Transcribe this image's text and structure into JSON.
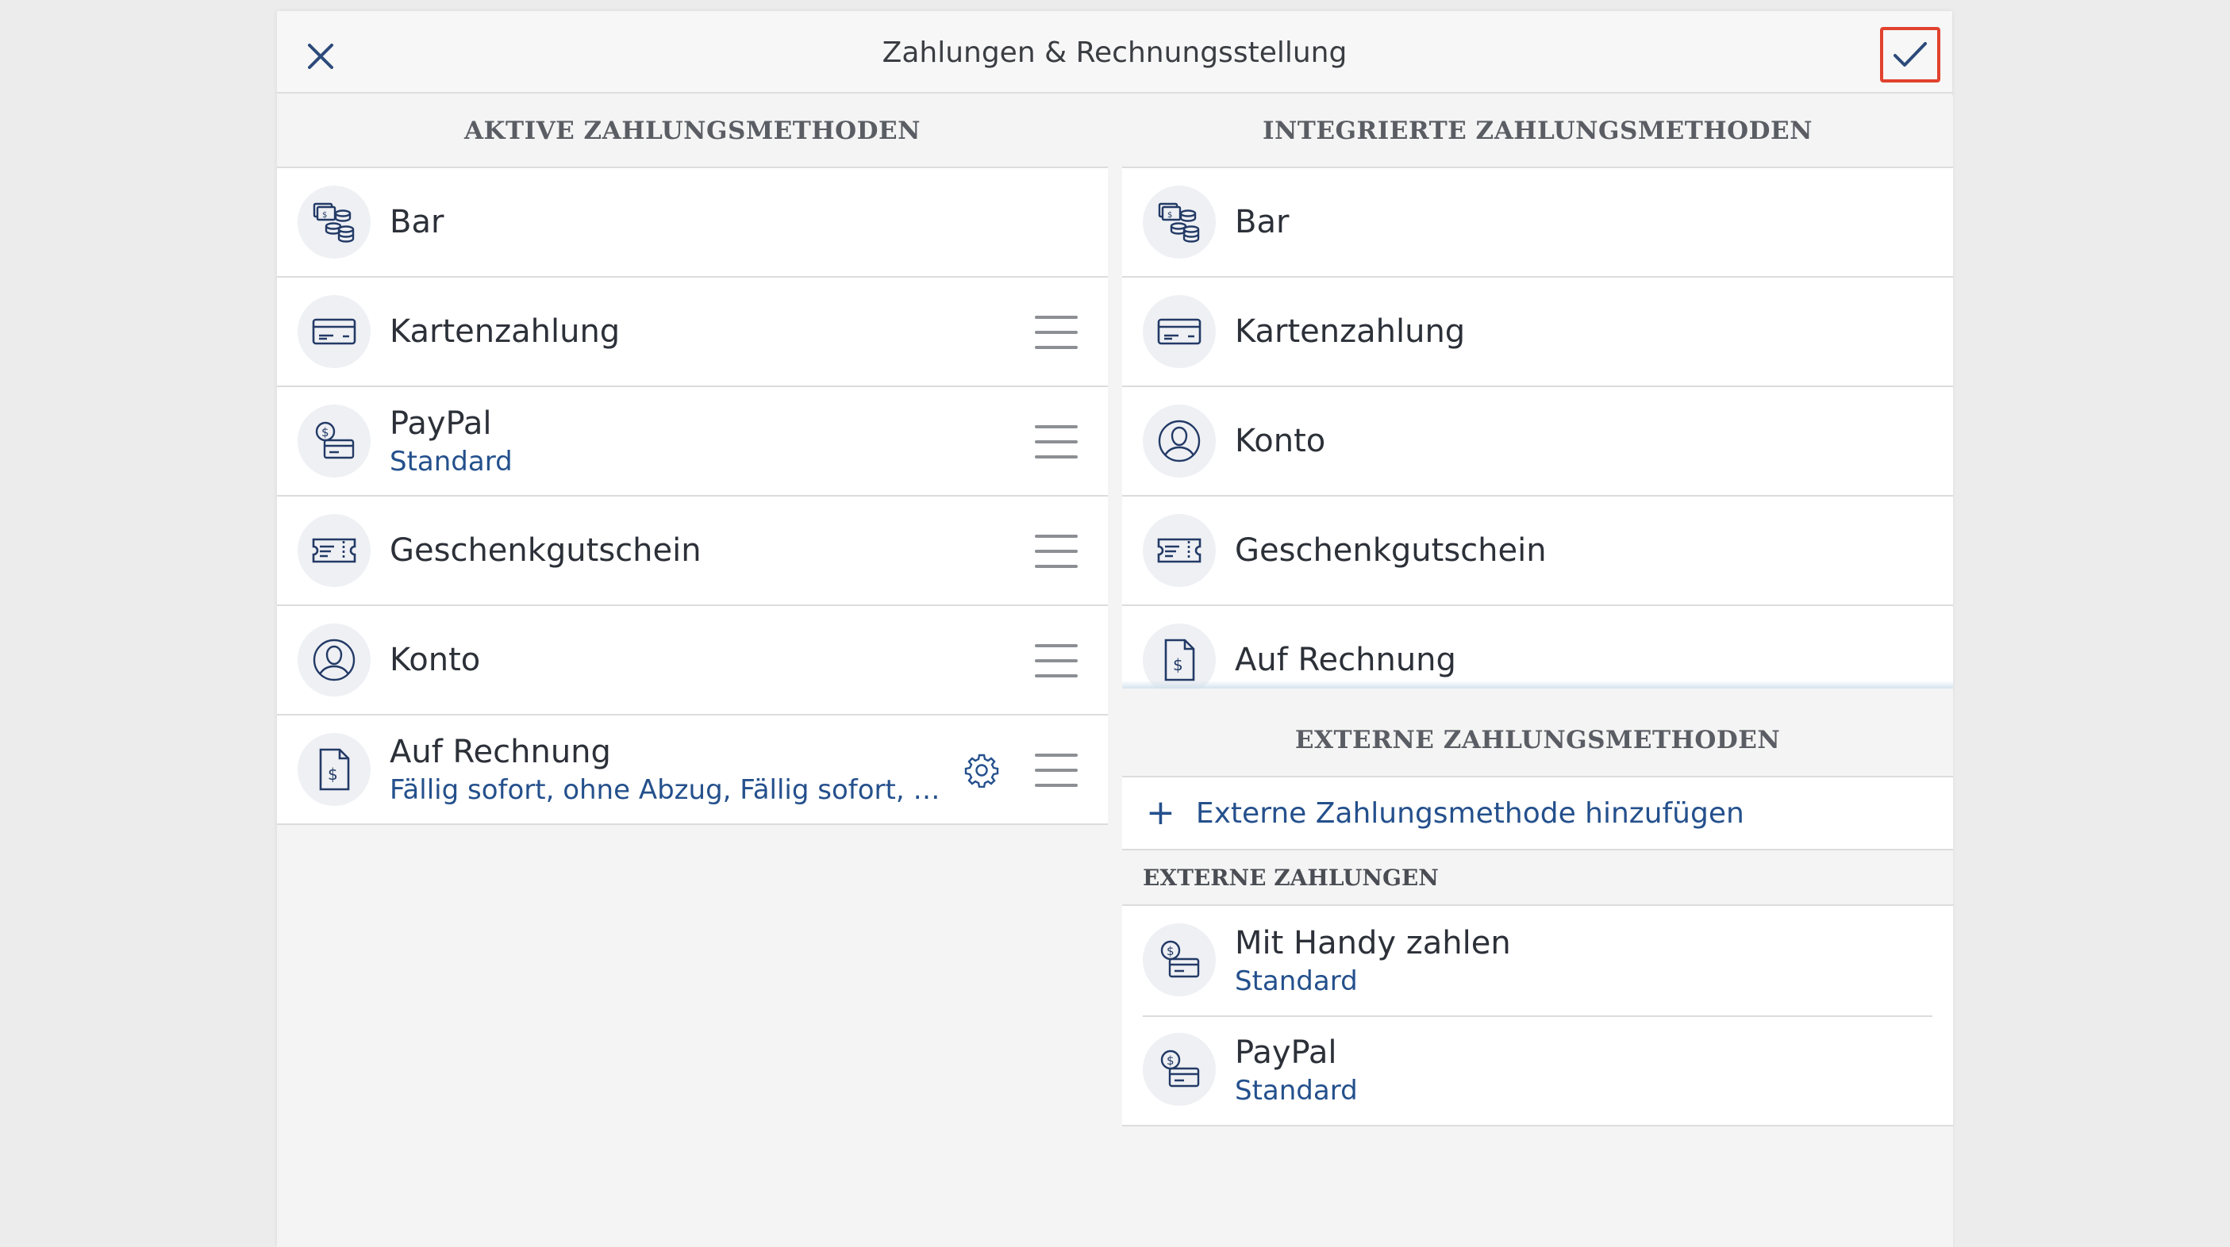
{
  "header": {
    "title": "Zahlungen & Rechnungsstellung",
    "close_icon": "close-icon",
    "confirm_icon": "checkmark-icon",
    "accent_color": "#e1422e"
  },
  "active": {
    "header": "AKTIVE ZAHLUNGSMETHODEN",
    "items": [
      {
        "title": "Bar",
        "subtitle": "",
        "icon": "cash-icon",
        "draggable": false,
        "settings": false
      },
      {
        "title": "Kartenzahlung",
        "subtitle": "",
        "icon": "card-icon",
        "draggable": true,
        "settings": false
      },
      {
        "title": "PayPal",
        "subtitle": "Standard",
        "icon": "dollar-card-icon",
        "draggable": true,
        "settings": false
      },
      {
        "title": "Geschenkgutschein",
        "subtitle": "",
        "icon": "voucher-icon",
        "draggable": true,
        "settings": false
      },
      {
        "title": "Konto",
        "subtitle": "",
        "icon": "person-icon",
        "draggable": true,
        "settings": false
      },
      {
        "title": "Auf Rechnung",
        "subtitle": "Fällig sofort, ohne Abzug, Fällig sofort, mit ...",
        "icon": "invoice-icon",
        "draggable": true,
        "settings": true
      }
    ]
  },
  "integrated": {
    "header": "INTEGRIERTE ZAHLUNGSMETHODEN",
    "items": [
      {
        "title": "Bar",
        "icon": "cash-icon"
      },
      {
        "title": "Kartenzahlung",
        "icon": "card-icon"
      },
      {
        "title": "Konto",
        "icon": "person-icon"
      },
      {
        "title": "Geschenkgutschein",
        "icon": "voucher-icon"
      },
      {
        "title": "Auf Rechnung",
        "icon": "invoice-icon"
      }
    ]
  },
  "external": {
    "header": "EXTERNE ZAHLUNGSMETHODEN",
    "add_label": "Externe Zahlungsmethode hinzufügen",
    "add_icon": "plus-icon",
    "payments_header": "EXTERNE ZAHLUNGEN",
    "items": [
      {
        "title": "Mit Handy zahlen",
        "subtitle": "Standard",
        "icon": "dollar-card-icon"
      },
      {
        "title": "PayPal",
        "subtitle": "Standard",
        "icon": "dollar-card-icon"
      }
    ]
  },
  "colors": {
    "link": "#24508c",
    "icon_stroke": "#233a66",
    "icon_bg": "#eef0f4"
  }
}
